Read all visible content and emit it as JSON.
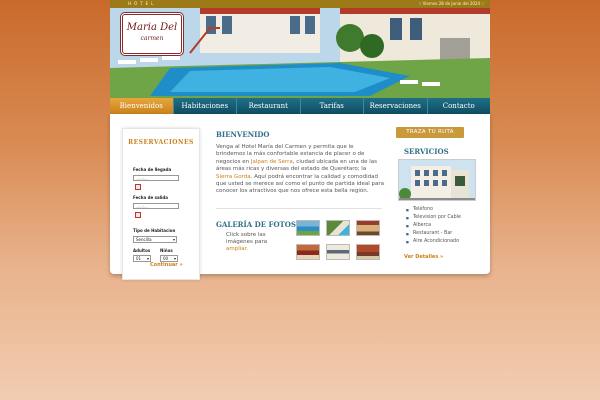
{
  "top_bar": {
    "hotel_word": "HOTEL",
    "date": ":: Viernes 28 de Junio del 2024 ::"
  },
  "logo": {
    "line1": "Maria Del",
    "line2": "carmen"
  },
  "nav": {
    "items": [
      {
        "label": "Bienvenidos",
        "active": true
      },
      {
        "label": "Habitaciones"
      },
      {
        "label": "Restaurant"
      },
      {
        "label": "Tarifas"
      },
      {
        "label": "Reservaciones"
      },
      {
        "label": "Contacto"
      }
    ]
  },
  "reservation": {
    "title": "RESERVACIONES",
    "checkin_label": "Fecha de llegada",
    "checkin_placeholder": "--/--/----",
    "checkout_label": "Fecha de salida",
    "checkout_placeholder": "--/--/----",
    "room_type_label": "Tipo de Habitacion",
    "room_type_value": "Sencilla",
    "adults_label": "Adultos",
    "adults_value": "01",
    "children_label": "Niños",
    "children_value": "00",
    "continue_label": "Continuar »"
  },
  "welcome": {
    "title": "BIENVENIDO",
    "text_before": "Venga al Hotel María del Carmen y permita que le brindemos la más confortable estancia de placer o de negocios en ",
    "link1": "Jalpan de Serra",
    "text_mid": ", ciudad ubicada en una de las áreas más ricas y diversas del estado de Querétaro; la ",
    "link2": "Sierra Gorda",
    "text_after": ". Aquí podrá encontrar la calidad y comodidad que usted se merece así como el punto de partida ideal para conocer los atractivos que nos ofrece esta bella región."
  },
  "gallery": {
    "title": "GALERÍA DE FOTOS",
    "text": "Click sobre las imágenes para",
    "link": "ampliar."
  },
  "route_button": "TRAZA TU RUTA",
  "services": {
    "title": "SERVICIOS",
    "items": [
      "Teléfono",
      "Television por Cable",
      "Alberca",
      "Restaurant - Bar",
      "Aire Acondicionado"
    ],
    "more_label": "Ver Detalles »"
  },
  "colors": {
    "accent": "#c9811c",
    "nav": "#1e6f87",
    "heading": "#2e6f86"
  }
}
